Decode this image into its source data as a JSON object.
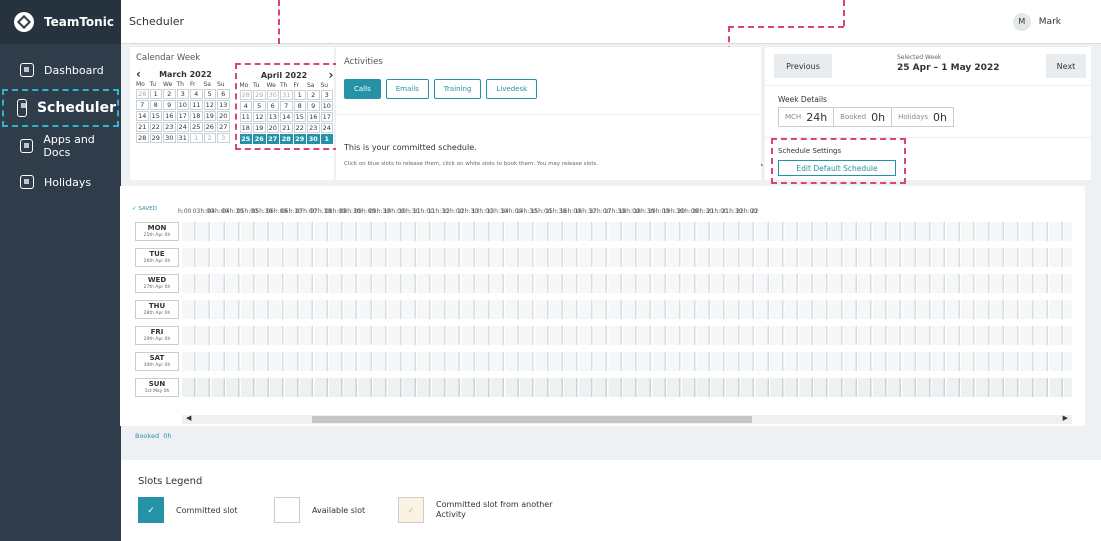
{
  "app": {
    "name": "TeamTonic"
  },
  "sidebar": {
    "items": [
      {
        "label": "Dashboard"
      },
      {
        "label": "Scheduler"
      },
      {
        "label": "Apps and Docs"
      },
      {
        "label": "Holidays"
      }
    ]
  },
  "topbar": {
    "title": "Scheduler",
    "user_initial": "M",
    "user_name": "Mark"
  },
  "calendar": {
    "title": "Calendar Week",
    "prev_month": "March 2022",
    "next_month": "April 2022",
    "prev_arrow": "‹",
    "next_arrow": "›",
    "dow": [
      "Mo",
      "Tu",
      "We",
      "Th",
      "Fr",
      "Sa",
      "Su"
    ],
    "march_days": [
      [
        "28",
        "o"
      ],
      [
        "1",
        ""
      ],
      [
        "2",
        ""
      ],
      [
        "3",
        ""
      ],
      [
        "4",
        ""
      ],
      [
        "5",
        ""
      ],
      [
        "6",
        ""
      ],
      [
        "7",
        ""
      ],
      [
        "8",
        ""
      ],
      [
        "9",
        ""
      ],
      [
        "10",
        ""
      ],
      [
        "11",
        ""
      ],
      [
        "12",
        ""
      ],
      [
        "13",
        ""
      ],
      [
        "14",
        ""
      ],
      [
        "15",
        ""
      ],
      [
        "16",
        ""
      ],
      [
        "17",
        ""
      ],
      [
        "18",
        ""
      ],
      [
        "19",
        ""
      ],
      [
        "20",
        ""
      ],
      [
        "21",
        ""
      ],
      [
        "22",
        ""
      ],
      [
        "23",
        ""
      ],
      [
        "24",
        ""
      ],
      [
        "25",
        ""
      ],
      [
        "26",
        ""
      ],
      [
        "27",
        ""
      ],
      [
        "28",
        ""
      ],
      [
        "29",
        ""
      ],
      [
        "30",
        ""
      ],
      [
        "31",
        ""
      ],
      [
        "1",
        "o"
      ],
      [
        "2",
        "o"
      ],
      [
        "3",
        "o"
      ]
    ],
    "april_days": [
      [
        "28",
        "o"
      ],
      [
        "29",
        "o"
      ],
      [
        "30",
        "o"
      ],
      [
        "31",
        "o"
      ],
      [
        "1",
        ""
      ],
      [
        "2",
        ""
      ],
      [
        "3",
        ""
      ],
      [
        "4",
        ""
      ],
      [
        "5",
        ""
      ],
      [
        "6",
        ""
      ],
      [
        "7",
        ""
      ],
      [
        "8",
        ""
      ],
      [
        "9",
        ""
      ],
      [
        "10",
        ""
      ],
      [
        "11",
        ""
      ],
      [
        "12",
        ""
      ],
      [
        "13",
        ""
      ],
      [
        "14",
        ""
      ],
      [
        "15",
        ""
      ],
      [
        "16",
        ""
      ],
      [
        "17",
        ""
      ],
      [
        "18",
        ""
      ],
      [
        "19",
        ""
      ],
      [
        "20",
        ""
      ],
      [
        "21",
        ""
      ],
      [
        "22",
        ""
      ],
      [
        "23",
        ""
      ],
      [
        "24",
        ""
      ],
      [
        "25",
        "s"
      ],
      [
        "26",
        "s"
      ],
      [
        "27",
        "s"
      ],
      [
        "28",
        "s"
      ],
      [
        "29",
        "s"
      ],
      [
        "30",
        "s"
      ],
      [
        "1",
        "s"
      ]
    ]
  },
  "activities": {
    "title": "Activities",
    "tabs": [
      "Calls",
      "Emails",
      "Training",
      "Livedesk"
    ],
    "active_tab": "Calls",
    "committed_text": "This is your committed schedule.",
    "help_text": "Click on blue slots to release them, click on white slots to book them. You may release slots."
  },
  "week": {
    "previous_label": "Previous",
    "next_label": "Next",
    "selected_label": "Selected Week",
    "selected_value": "25 Apr – 1 May 2022",
    "details_title": "Week Details",
    "mch_label": "MCH",
    "mch_value": "24h",
    "booked_label": "Booked",
    "booked_value": "0h",
    "holidays_label": "Holidays",
    "holidays_value": "0h"
  },
  "schedule_settings": {
    "title": "Schedule Settings",
    "button": "Edit Default Schedule"
  },
  "grid": {
    "saved": "✓ SAVED",
    "hours": [
      "h:00",
      "03h:00",
      "04h:00",
      "04h:30",
      "05h:00",
      "05h:30",
      "06h:00",
      "06h:30",
      "07h:00",
      "07h:30",
      "08h:00",
      "08h:30",
      "09h:00",
      "09h:30",
      "10h:00",
      "10h:30",
      "11h:00",
      "11h:30",
      "12h:00",
      "12h:30",
      "13h:00",
      "13h:30",
      "14h:00",
      "14h:30",
      "15h:00",
      "15h:30",
      "16h:00",
      "16h:30",
      "17h:00",
      "17h:30",
      "18h:00",
      "18h:30",
      "19h:00",
      "19h:30",
      "20h:00",
      "20h:30",
      "21h:00",
      "21h:30",
      "22h:00",
      "22"
    ],
    "days": [
      {
        "name": "MON",
        "date": "25th Apr"
      },
      {
        "name": "TUE",
        "date": "26th Apr"
      },
      {
        "name": "WED",
        "date": "27th Apr"
      },
      {
        "name": "THU",
        "date": "28th Apr"
      },
      {
        "name": "FRI",
        "date": "29th Apr"
      },
      {
        "name": "SAT",
        "date": "30th Apr"
      },
      {
        "name": "SUN",
        "date": "1st May"
      }
    ],
    "day_hours": "0h",
    "booked_label": "Booked",
    "booked_value": "0h"
  },
  "legend": {
    "title": "Slots Legend",
    "committed": "Committed slot",
    "available": "Available slot",
    "other_1": "Committed slot from another",
    "other_2": "Activity",
    "check": "✓"
  },
  "colors": {
    "accent": "#2592a8",
    "sidebar": "#2f3d4b",
    "highlight_pink": "#d9447a",
    "highlight_cyan": "#2fb4cf"
  }
}
